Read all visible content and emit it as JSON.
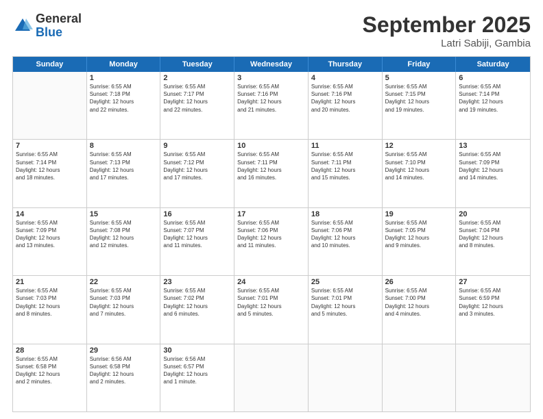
{
  "logo": {
    "general": "General",
    "blue": "Blue"
  },
  "title": "September 2025",
  "location": "Latri Sabiji, Gambia",
  "header_days": [
    "Sunday",
    "Monday",
    "Tuesday",
    "Wednesday",
    "Thursday",
    "Friday",
    "Saturday"
  ],
  "weeks": [
    [
      {
        "day": "",
        "info": ""
      },
      {
        "day": "1",
        "info": "Sunrise: 6:55 AM\nSunset: 7:18 PM\nDaylight: 12 hours\nand 22 minutes."
      },
      {
        "day": "2",
        "info": "Sunrise: 6:55 AM\nSunset: 7:17 PM\nDaylight: 12 hours\nand 22 minutes."
      },
      {
        "day": "3",
        "info": "Sunrise: 6:55 AM\nSunset: 7:16 PM\nDaylight: 12 hours\nand 21 minutes."
      },
      {
        "day": "4",
        "info": "Sunrise: 6:55 AM\nSunset: 7:16 PM\nDaylight: 12 hours\nand 20 minutes."
      },
      {
        "day": "5",
        "info": "Sunrise: 6:55 AM\nSunset: 7:15 PM\nDaylight: 12 hours\nand 19 minutes."
      },
      {
        "day": "6",
        "info": "Sunrise: 6:55 AM\nSunset: 7:14 PM\nDaylight: 12 hours\nand 19 minutes."
      }
    ],
    [
      {
        "day": "7",
        "info": "Sunrise: 6:55 AM\nSunset: 7:14 PM\nDaylight: 12 hours\nand 18 minutes."
      },
      {
        "day": "8",
        "info": "Sunrise: 6:55 AM\nSunset: 7:13 PM\nDaylight: 12 hours\nand 17 minutes."
      },
      {
        "day": "9",
        "info": "Sunrise: 6:55 AM\nSunset: 7:12 PM\nDaylight: 12 hours\nand 17 minutes."
      },
      {
        "day": "10",
        "info": "Sunrise: 6:55 AM\nSunset: 7:11 PM\nDaylight: 12 hours\nand 16 minutes."
      },
      {
        "day": "11",
        "info": "Sunrise: 6:55 AM\nSunset: 7:11 PM\nDaylight: 12 hours\nand 15 minutes."
      },
      {
        "day": "12",
        "info": "Sunrise: 6:55 AM\nSunset: 7:10 PM\nDaylight: 12 hours\nand 14 minutes."
      },
      {
        "day": "13",
        "info": "Sunrise: 6:55 AM\nSunset: 7:09 PM\nDaylight: 12 hours\nand 14 minutes."
      }
    ],
    [
      {
        "day": "14",
        "info": "Sunrise: 6:55 AM\nSunset: 7:09 PM\nDaylight: 12 hours\nand 13 minutes."
      },
      {
        "day": "15",
        "info": "Sunrise: 6:55 AM\nSunset: 7:08 PM\nDaylight: 12 hours\nand 12 minutes."
      },
      {
        "day": "16",
        "info": "Sunrise: 6:55 AM\nSunset: 7:07 PM\nDaylight: 12 hours\nand 11 minutes."
      },
      {
        "day": "17",
        "info": "Sunrise: 6:55 AM\nSunset: 7:06 PM\nDaylight: 12 hours\nand 11 minutes."
      },
      {
        "day": "18",
        "info": "Sunrise: 6:55 AM\nSunset: 7:06 PM\nDaylight: 12 hours\nand 10 minutes."
      },
      {
        "day": "19",
        "info": "Sunrise: 6:55 AM\nSunset: 7:05 PM\nDaylight: 12 hours\nand 9 minutes."
      },
      {
        "day": "20",
        "info": "Sunrise: 6:55 AM\nSunset: 7:04 PM\nDaylight: 12 hours\nand 8 minutes."
      }
    ],
    [
      {
        "day": "21",
        "info": "Sunrise: 6:55 AM\nSunset: 7:03 PM\nDaylight: 12 hours\nand 8 minutes."
      },
      {
        "day": "22",
        "info": "Sunrise: 6:55 AM\nSunset: 7:03 PM\nDaylight: 12 hours\nand 7 minutes."
      },
      {
        "day": "23",
        "info": "Sunrise: 6:55 AM\nSunset: 7:02 PM\nDaylight: 12 hours\nand 6 minutes."
      },
      {
        "day": "24",
        "info": "Sunrise: 6:55 AM\nSunset: 7:01 PM\nDaylight: 12 hours\nand 5 minutes."
      },
      {
        "day": "25",
        "info": "Sunrise: 6:55 AM\nSunset: 7:01 PM\nDaylight: 12 hours\nand 5 minutes."
      },
      {
        "day": "26",
        "info": "Sunrise: 6:55 AM\nSunset: 7:00 PM\nDaylight: 12 hours\nand 4 minutes."
      },
      {
        "day": "27",
        "info": "Sunrise: 6:55 AM\nSunset: 6:59 PM\nDaylight: 12 hours\nand 3 minutes."
      }
    ],
    [
      {
        "day": "28",
        "info": "Sunrise: 6:55 AM\nSunset: 6:58 PM\nDaylight: 12 hours\nand 2 minutes."
      },
      {
        "day": "29",
        "info": "Sunrise: 6:56 AM\nSunset: 6:58 PM\nDaylight: 12 hours\nand 2 minutes."
      },
      {
        "day": "30",
        "info": "Sunrise: 6:56 AM\nSunset: 6:57 PM\nDaylight: 12 hours\nand 1 minute."
      },
      {
        "day": "",
        "info": ""
      },
      {
        "day": "",
        "info": ""
      },
      {
        "day": "",
        "info": ""
      },
      {
        "day": "",
        "info": ""
      }
    ]
  ]
}
